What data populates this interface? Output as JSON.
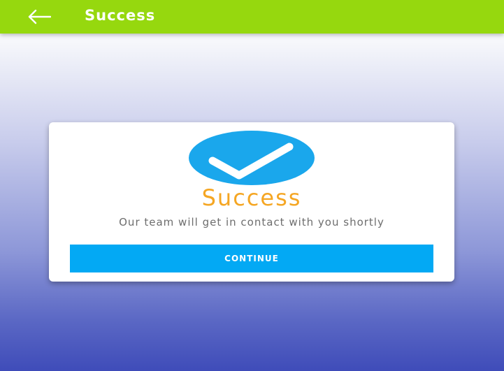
{
  "app_bar": {
    "title": "Success",
    "back_icon": "arrow-left-icon",
    "background": "#96d80e"
  },
  "card": {
    "icon": "check-circle-icon",
    "icon_color": "#1aa7ec",
    "heading": "Success",
    "heading_color": "#f5a623",
    "message": "Our team will get in contact with you shortly",
    "button_label": "CONTINUE",
    "button_color": "#03a9f4"
  }
}
